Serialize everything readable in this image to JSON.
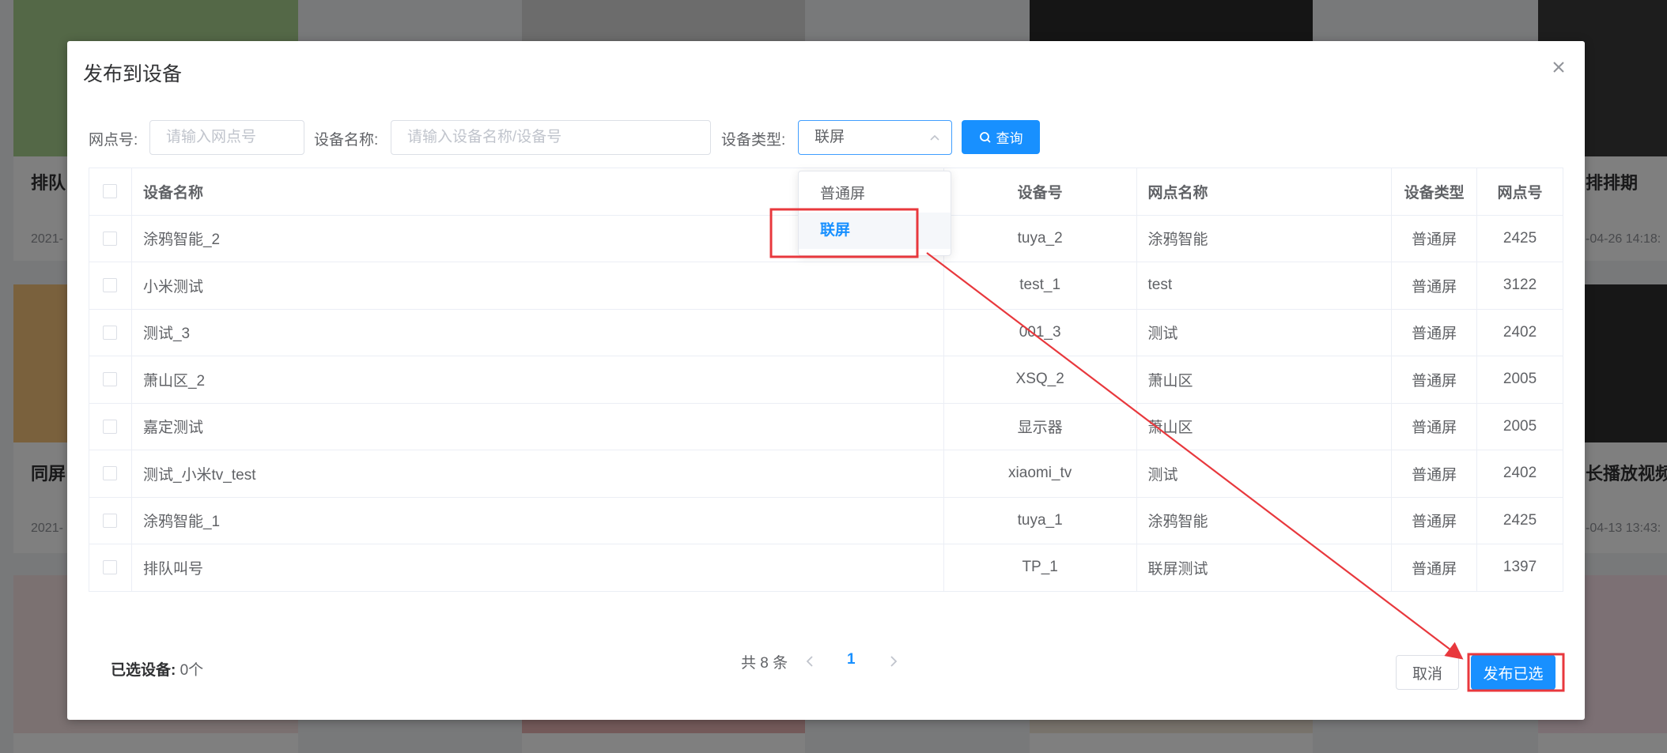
{
  "background": {
    "cards": [
      {
        "title": "排队",
        "date": "2021-"
      },
      {
        "title": "排排期",
        "date": "-04-26 14:18:"
      },
      {
        "title": "同屏",
        "date": "2021-"
      },
      {
        "title": "长播放视频",
        "date": "-04-13 13:43:"
      }
    ]
  },
  "dialog": {
    "title": "发布到设备",
    "filters": {
      "branch_label": "网点号:",
      "branch_placeholder": "请输入网点号",
      "device_label": "设备名称:",
      "device_placeholder": "请输入设备名称/设备号",
      "type_label": "设备类型:",
      "type_value": "联屏",
      "query_label": "查询"
    },
    "dropdown": {
      "options": [
        "普通屏",
        "联屏"
      ],
      "selected": "联屏"
    },
    "table": {
      "headers": [
        "设备名称",
        "设备号",
        "网点名称",
        "设备类型",
        "网点号"
      ],
      "rows": [
        [
          "涂鸦智能_2",
          "tuya_2",
          "涂鸦智能",
          "普通屏",
          "2425"
        ],
        [
          "小米测试",
          "test_1",
          "test",
          "普通屏",
          "3122"
        ],
        [
          "测试_3",
          "001_3",
          "测试",
          "普通屏",
          "2402"
        ],
        [
          "萧山区_2",
          "XSQ_2",
          "萧山区",
          "普通屏",
          "2005"
        ],
        [
          "嘉定测试",
          "显示器",
          "萧山区",
          "普通屏",
          "2005"
        ],
        [
          "测试_小米tv_test",
          "xiaomi_tv",
          "测试",
          "普通屏",
          "2402"
        ],
        [
          "涂鸦智能_1",
          "tuya_1",
          "涂鸦智能",
          "普通屏",
          "2425"
        ],
        [
          "排队叫号",
          "TP_1",
          "联屏测试",
          "普通屏",
          "1397"
        ]
      ]
    },
    "pagination": {
      "total": "共 8 条",
      "current_page": "1"
    },
    "footer": {
      "selected_label": "已选设备:",
      "selected_count": "0个",
      "cancel_label": "取消",
      "publish_label": "发布已选"
    }
  },
  "colors": {
    "primary": "#1890ff",
    "annotation": "#e8383d",
    "overlay": "rgba(0,0,0,0.5)"
  }
}
